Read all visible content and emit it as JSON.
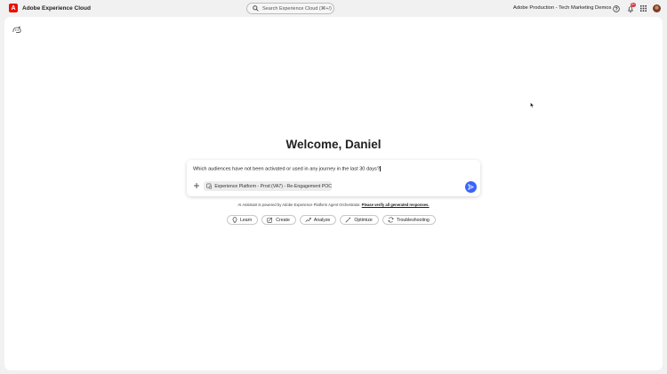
{
  "header": {
    "brand_name": "Adobe Experience Cloud",
    "brand_logo_letter": "A",
    "search_placeholder": "Search Experience Cloud (⌘+/)",
    "org_name": "Adobe Production - Tech Marketing Demos",
    "notification_count": "9+",
    "icons": [
      "help-icon",
      "bell-icon",
      "apps-grid-icon"
    ],
    "accent_color": "#eb1000"
  },
  "assistant": {
    "welcome": "Welcome, Daniel",
    "prompt_text": "Which audiences have not been activated or used in any journey in the last 30 days?",
    "context_chip": "Experience Platform - Prod (VA7) - Re-Engagement POC",
    "disclaimer_prefix": "AI Assistant is powered by Adobe Experience Platform Agent Orchestrator.",
    "disclaimer_link": "Please verify all generated responses.",
    "send_color": "#3b63fb"
  },
  "quick_actions": [
    {
      "label": "Learn",
      "icon": "lightbulb-icon"
    },
    {
      "label": "Create",
      "icon": "create-icon"
    },
    {
      "label": "Analyze",
      "icon": "chart-line-icon"
    },
    {
      "label": "Optimize",
      "icon": "magic-wand-icon"
    },
    {
      "label": "Troubleshooting",
      "icon": "troubleshoot-icon"
    }
  ]
}
